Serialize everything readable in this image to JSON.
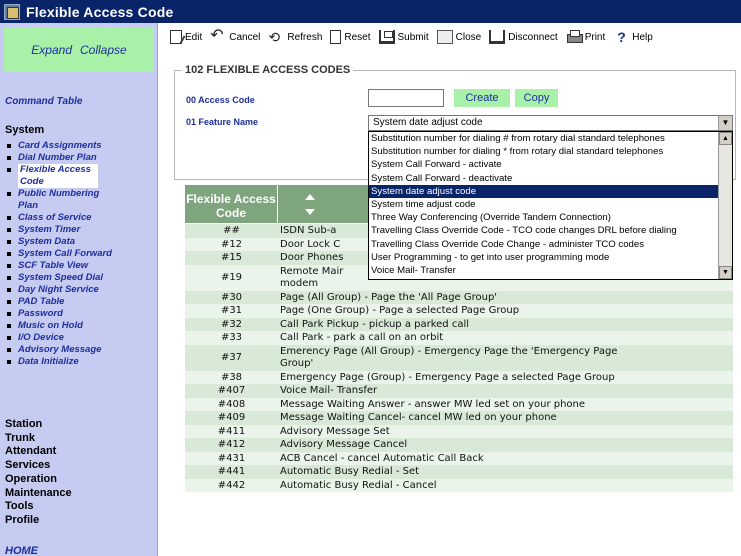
{
  "window": {
    "title": "Flexible Access Code"
  },
  "sidebar": {
    "expand": "Expand",
    "collapse": "Collapse",
    "command_table": "Command Table",
    "system_heading": "System",
    "system_items": [
      "Card Assignments",
      "Dial Number Plan",
      "Flexible Access Code",
      "Public Numbering Plan",
      "Class of Service",
      "System Timer",
      "System Data",
      "System Call Forward",
      "SCF Table View",
      "System Speed Dial",
      "Day Night Service",
      "PAD Table",
      "Password",
      "Music on Hold",
      "I/O Device",
      "Advisory Message",
      "Data Initialize"
    ],
    "top_items": [
      "Station",
      "Trunk",
      "Attendant",
      "Services",
      "Operation",
      "Maintenance",
      "Tools",
      "Profile"
    ],
    "home": "HOME"
  },
  "toolbar": {
    "edit": "Edit",
    "cancel": "Cancel",
    "refresh": "Refresh",
    "reset": "Reset",
    "submit": "Submit",
    "close": "Close",
    "disconnect": "Disconnect",
    "print": "Print",
    "help": "Help"
  },
  "form": {
    "legend": "102 FLEXIBLE ACCESS CODES",
    "access_code_label": "00 Access Code",
    "access_code_value": "",
    "create_button": "Create",
    "copy_button": "Copy",
    "feature_name_label": "01 Feature Name",
    "feature_name_selected": "System date adjust code",
    "dropdown_options": [
      "Substitution number for dialing # from rotary dial standard telephones",
      "Substitution number for dialing * from rotary dial standard telephones",
      "System Call Forward - activate",
      "System Call Forward - deactivate",
      "System date adjust code",
      "System time adjust code",
      "Three Way Conferencing (Override Tandem Connection)",
      "Travelling Class Override Code - TCO code changes DRL before dialing",
      "Travelling Class Override Code Change - administer TCO codes",
      "User Programming - to get into user programming mode",
      "Voice Mail- Transfer"
    ]
  },
  "table": {
    "header_code": "Flexible Access Code",
    "rows": [
      {
        "code": "##",
        "name": "ISDN Sub-a"
      },
      {
        "code": "#12",
        "name": "Door Lock C"
      },
      {
        "code": "#15",
        "name": "Door Phones"
      },
      {
        "code": "#19",
        "name": "Remote Mair modem"
      },
      {
        "code": "#30",
        "name": "Page (All Group) - Page the 'All Page Group'"
      },
      {
        "code": "#31",
        "name": "Page (One Group) - Page a selected Page Group"
      },
      {
        "code": "#32",
        "name": "Call Park Pickup - pickup a parked call"
      },
      {
        "code": "#33",
        "name": "Call Park - park a call on an orbit"
      },
      {
        "code": "#37",
        "name": "Emerency Page (All Group) - Emergency Page the 'Emergency Page Group'"
      },
      {
        "code": "#38",
        "name": "Emergency Page (Group) - Emergency Page a selected Page Group"
      },
      {
        "code": "#407",
        "name": "Voice Mail- Transfer"
      },
      {
        "code": "#408",
        "name": "Message Waiting Answer - answer MW led set on your phone"
      },
      {
        "code": "#409",
        "name": "Message Waiting Cancel- cancel MW led on your phone"
      },
      {
        "code": "#411",
        "name": "Advisory Message Set"
      },
      {
        "code": "#412",
        "name": "Advisory Message Cancel"
      },
      {
        "code": "#431",
        "name": "ACB Cancel - cancel Automatic Call Back"
      },
      {
        "code": "#441",
        "name": "Automatic Busy Redial - Set"
      },
      {
        "code": "#442",
        "name": "Automatic Busy Redial - Cancel"
      }
    ]
  },
  "colors": {
    "sidebar_bg": "#c6cbf2",
    "green_button": "#a9f0a8",
    "table_header": "#7fa57f",
    "selection": "#0a246a"
  }
}
